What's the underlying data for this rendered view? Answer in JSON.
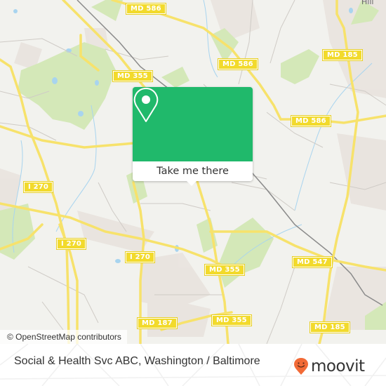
{
  "map": {
    "road_labels": [
      {
        "id": "md586-top",
        "text": "MD 586"
      },
      {
        "id": "md586-mid",
        "text": "MD 586"
      },
      {
        "id": "md586-right",
        "text": "MD 586"
      },
      {
        "id": "md185-top",
        "text": "MD 185"
      },
      {
        "id": "md355-top",
        "text": "MD 355"
      },
      {
        "id": "i270-a",
        "text": "I 270"
      },
      {
        "id": "i270-b",
        "text": "I 270"
      },
      {
        "id": "i270-c",
        "text": "I 270"
      },
      {
        "id": "md355-mid",
        "text": "MD 355"
      },
      {
        "id": "md547",
        "text": "MD 547"
      },
      {
        "id": "md187",
        "text": "MD 187"
      },
      {
        "id": "md355-bottom",
        "text": "MD 355"
      },
      {
        "id": "md185-bottom",
        "text": "MD 185"
      }
    ],
    "place_labels": [
      {
        "text": "Hill"
      }
    ],
    "attribution": "© OpenStreetMap contributors",
    "colors": {
      "background": "#f2f2ee",
      "park": "#d4e8b8",
      "road_major": "#f7e26b",
      "water": "#a8d4ef",
      "urban": "#e9e3de"
    }
  },
  "popup": {
    "icon": "map-pin-icon",
    "action_label": "Take me there",
    "accent_color": "#20b96b"
  },
  "footer": {
    "place_title": "Social & Health Svc ABC, Washington / Baltimore",
    "brand": {
      "name": "moovit",
      "icon": "moovit-smile-pin-icon",
      "icon_color": "#f26a36"
    }
  }
}
